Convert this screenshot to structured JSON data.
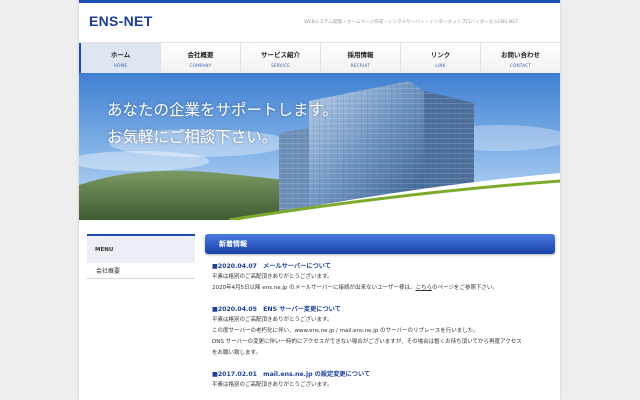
{
  "header": {
    "logo": "ENS-NET",
    "tagline": "WEBシステム開発・ホームページ作成・レンタルサーバー・インターネットプロバイダーならENS-NET"
  },
  "nav": [
    {
      "label": "ホーム",
      "sub": "HOME"
    },
    {
      "label": "会社概要",
      "sub": "COMPANY"
    },
    {
      "label": "サービス紹介",
      "sub": "SERVICE"
    },
    {
      "label": "採用情報",
      "sub": "RECRUIT"
    },
    {
      "label": "リンク",
      "sub": "LINK"
    },
    {
      "label": "お問い合わせ",
      "sub": "CONTACT"
    }
  ],
  "hero": {
    "line1": "あなたの企業をサポートします。",
    "line2": "お気軽にご相談下さい。"
  },
  "sidebar": {
    "menu_title": "MENU",
    "items": [
      "会社概要"
    ]
  },
  "news": {
    "title": "新着情報",
    "entries": [
      {
        "title": "■2020.04.07　メールサーバーについて",
        "lines": [
          "平素は格別のご高配頂きありがとうございます。",
          "2020年4月5日以降 ens.ne.jp のメールサーバーに接続が出来ないユーザー様は、"
        ],
        "link_text": "こちら",
        "link_suffix": "のページをご参照下さい。"
      },
      {
        "title": "■2020.04.05　ENS サーバー変更について",
        "lines": [
          "平素は格別のご高配頂きありがとうございます。",
          "この度サーバーの老朽化に伴い、www.ens.ne.jp / mail.ens.ne.jp のサーバーのリプレースを行いました。",
          "DNS サーバーの変更に伴い一時的にアクセスができない場合がございますが、その場合は暫くお待ち頂いてから再度アクセス",
          "をお願い致します。"
        ]
      },
      {
        "title": "■2017.02.01　mail.ens.ne.jp の設定変更について",
        "lines": [
          "平素は格別のご高配頂きありがとうございます。"
        ]
      }
    ]
  },
  "colors": {
    "brand_blue": "#1a4fb4",
    "logo_blue": "#1d3f9a",
    "page_bg": "#eeeeee"
  }
}
